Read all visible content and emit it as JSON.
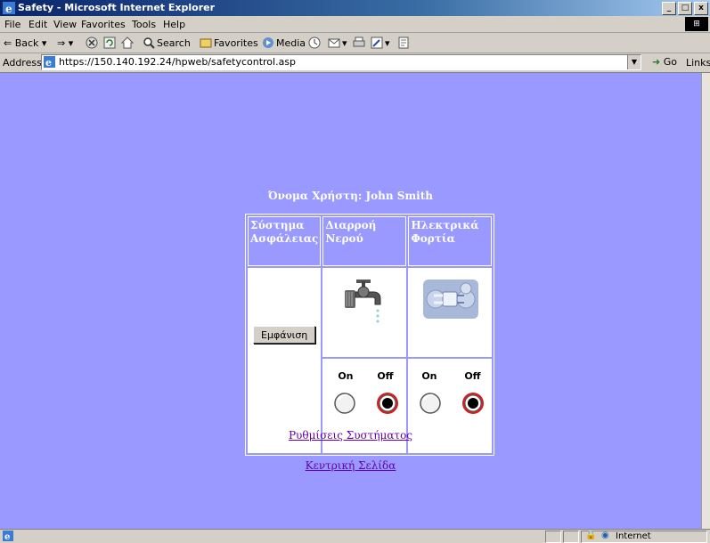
{
  "window": {
    "title": "Safety - Microsoft Internet Explorer",
    "controls": [
      "_",
      "□",
      "x"
    ]
  },
  "menu": {
    "items": [
      "File",
      "Edit",
      "View",
      "Favorites",
      "Tools",
      "Help"
    ]
  },
  "toolbar": {
    "back_label": "Back",
    "search_label": "Search",
    "favorites_label": "Favorites",
    "media_label": "Media"
  },
  "address": {
    "label": "Address",
    "url": "https://150.140.192.24/hpweb/safetycontrol.asp",
    "go_label": "Go",
    "links_label": "Links"
  },
  "page": {
    "user_line": "Όνομα Χρήστη: John Smith",
    "table": {
      "headers": [
        "Σύστημα Ασφάλειας",
        "Διαρροή Νερού",
        "Ηλεκτρικά Φορτία"
      ],
      "show_button": "Εμφάνιση",
      "water": {
        "on_label": "On",
        "off_label": "Off",
        "state": "off"
      },
      "electric": {
        "on_label": "On",
        "off_label": "Off",
        "state": "off"
      }
    },
    "links": {
      "settings": "Ρυθμίσεις Συστήματος",
      "home": "Κεντρική Σελίδα"
    }
  },
  "status": {
    "zone": "Internet"
  },
  "colors": {
    "page_background": "#9999ff",
    "link": "#6600aa",
    "selected_ring": "#cc2222"
  },
  "icons": {
    "page": "page-icon",
    "water": "water-tap-icon",
    "electric": "electric-plug-icon"
  }
}
